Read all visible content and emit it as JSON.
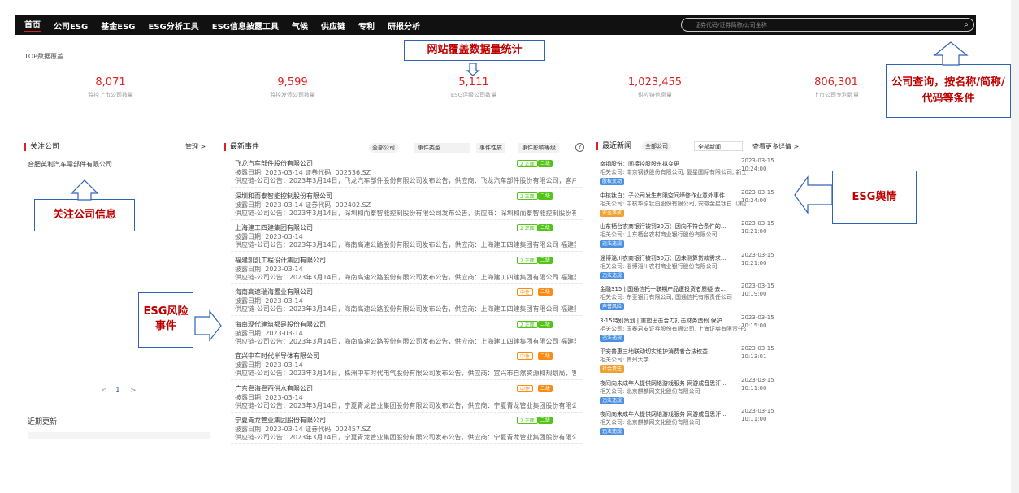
{
  "nav": {
    "items": [
      "首页",
      "公司ESG",
      "基金ESG",
      "ESG分析工具",
      "ESG信息披露工具",
      "气候",
      "供应链",
      "专利",
      "研报分析"
    ],
    "search_placeholder": "证券代码/证券简称/公司全称"
  },
  "top": {
    "title": "TOP数据覆盖",
    "stats": [
      {
        "value": "8,071",
        "label": "监控上市公司数量"
      },
      {
        "value": "9,599",
        "label": "监控发债公司数量"
      },
      {
        "value": "5,111",
        "label": "ESG评级公司数量"
      },
      {
        "value": "1,023,455",
        "label": "供应链信息量"
      },
      {
        "value": "806,301",
        "label": "上市公司专利数量"
      }
    ]
  },
  "annotations": {
    "coverage": "网站覆盖数据量统计",
    "query": "公司查询，按名称/简称/代码等条件",
    "follow": "关注公司信息",
    "risk": "ESG风险事件",
    "sentiment": "ESG舆情"
  },
  "follow": {
    "title": "关注公司",
    "manage": "管理 >",
    "company": "合肥英利汽车零部件有限公司",
    "pager": [
      "<",
      "1",
      ">"
    ]
  },
  "updates": {
    "title": "近期更新"
  },
  "events": {
    "title": "最新事件",
    "filters": [
      "全部公司",
      "事件类型",
      "事件性质",
      "事件影响等级"
    ],
    "items": [
      {
        "title": "飞龙汽车部件股份有限公司",
        "date": "披露日期: 2023-03-14",
        "code": "证券代码: 002536.SZ",
        "desc": "供应链-公司公告：2023年3月14日，飞龙汽车部件股份有限公司发布公告，供应商：飞龙汽车部件股份有限公司，客户：...",
        "b1": "2 正面",
        "b2": "二级"
      },
      {
        "title": "深圳和而泰智能控制股份有限公司",
        "date": "披露日期: 2023-03-14",
        "code": "证券代码: 002402.SZ",
        "desc": "供应链-公司公告：2023年3月14日，深圳和而泰智能控制股份有限公司发布公告，供应商：深圳和而泰智能控制股份有限公司...",
        "b1": "2 正面",
        "b2": "二级"
      },
      {
        "title": "上海建工四建集团有限公司",
        "date": "披露日期: 2023-03-14",
        "code": "",
        "desc": "供应链-公司公告：2023年3月14日，海南高速公路股份有限公司发布公告，供应商：上海建工四建集团有限公司 福建凯凯...",
        "b1": "2 正面",
        "b2": "二级"
      },
      {
        "title": "福建凯凯工程设计集团有限公司",
        "date": "披露日期: 2023-03-14",
        "code": "",
        "desc": "供应链-公司公告：2023年3月14日，海南高速公路股份有限公司发布公告，供应商：上海建工四建集团有限公司 福建凯凯...",
        "b1": "2 正面",
        "b2": "二级"
      },
      {
        "title": "海南高速瑞海置业有限公司",
        "date": "披露日期: 2023-03-14",
        "code": "",
        "desc": "供应链-公司公告：2023年3月14日，海南高速公路股份有限公司发布公告，供应商：上海建工四建集团有限公司 福建凯凯...",
        "b1": "中性",
        "b2": "二级"
      },
      {
        "title": "海南现代建筑都是股份有限公司",
        "date": "披露日期: 2023-03-14",
        "code": "",
        "desc": "供应链-公司公告：2023年3月14日，海南高速公路股份有限公司发布公告，供应商：上海建工四建集团有限公司 福建凯凯...",
        "b1": "2 正面",
        "b2": "二级"
      },
      {
        "title": "宜兴中车时代半导体有限公司",
        "date": "披露日期: 2023-03-14",
        "code": "",
        "desc": "供应链-公司公告：2023年3月14日，株洲中车时代电气股份有限公司发布公告，供应商：宜兴市自然资源和规划局，客户...",
        "b1": "中性",
        "b2": "二级"
      },
      {
        "title": "广东粤海粤西供水有限公司",
        "date": "披露日期: 2023-03-14",
        "code": "",
        "desc": "供应链-公司公告：2023年3月14日，宁夏青龙管业集团股份有限公司发布公告，供应商：宁夏青龙管业集团股份有限公司...",
        "b1": "中性",
        "b2": "二级"
      },
      {
        "title": "宁夏青龙管业集团股份有限公司",
        "date": "披露日期: 2023-03-14",
        "code": "证券代码: 002457.SZ",
        "desc": "供应链-公司公告：2023年3月14日，宁夏青龙管业集团股份有限公司发布公告，供应商：宁夏青龙管业集团股份有限公司...",
        "b1": "2 正面",
        "b2": "二级"
      }
    ]
  },
  "news": {
    "title": "最近新闻",
    "filters": [
      "全部公司",
      "全部新闻"
    ],
    "more": "查看更多详情 >",
    "items": [
      {
        "title": "南钢股份：间接控股股东拟变更",
        "company": "相关公司: 南京钢铁股份有限公司, 复星国际有限公司, 新工方股...",
        "tag": "股权变动",
        "time": "2023-03-15 10:24:00"
      },
      {
        "title": "中核钛白：子公司发生有限空间缔修作业意外事件",
        "company": "相关公司: 中核华原钛白股份有限公司, 安徽金星钛白（集团）有限...",
        "tag": "安全事故",
        "time": "2023-03-15 10:24:00"
      },
      {
        "title": "山东栖台农商银行被罚30万：因向不符合条件的...",
        "company": "相关公司: 山东栖台农村商业银行股份有限公司",
        "tag": "违法违规",
        "time": "2023-03-15 10:21:00"
      },
      {
        "title": "淄博淄川农商银行被罚30万：因未测算贷款需求...",
        "company": "相关公司: 淄博淄川农村商业银行股份有限公司",
        "tag": "违法违规",
        "time": "2023-03-15 10:21:00"
      },
      {
        "title": "金融315 | 国通信托一联期产品遭投资者质疑 去...",
        "company": "相关公司: 东亚银行有限公司, 国通信托有限责任公司",
        "tag": "声誉风险",
        "time": "2023-03-15 10:19:00"
      },
      {
        "title": "3·15特别策划 | 重塑出击合力打击财务造假 保护...",
        "company": "相关公司: 国泰君安证券股份有限公司, 上海证券有限责任公司, 华...",
        "tag": "违法违规",
        "time": "2023-03-15 10:15:00"
      },
      {
        "title": "平安普惠三地联动切实维护消费者合法权益",
        "company": "相关公司: 贵州大学",
        "tag": "社会责任",
        "time": "2023-03-15 10:13:01"
      },
      {
        "title": "夜间向未成年人提供网络游戏服务 网游成音思汗...",
        "company": "相关公司: 北京麒麟网文化股份有限公司",
        "tag": "违法违规",
        "time": "2023-03-15 10:11:00"
      },
      {
        "title": "夜间向未成年人提供网络游戏服务 网游成音思汗...",
        "company": "相关公司: 北京麒麟网文化股份有限公司",
        "tag": "违法违规",
        "time": "2023-03-15 10:11:00"
      }
    ]
  },
  "colors": {
    "accent": "#e02020",
    "nav_bg": "#111111",
    "annotation_border": "#2e62b8",
    "annotation_text": "#c00000",
    "positive": "#52c41a",
    "neutral": "#fa8c16",
    "tag_blue": "#4a90e2",
    "tag_orange": "#f0a030"
  }
}
